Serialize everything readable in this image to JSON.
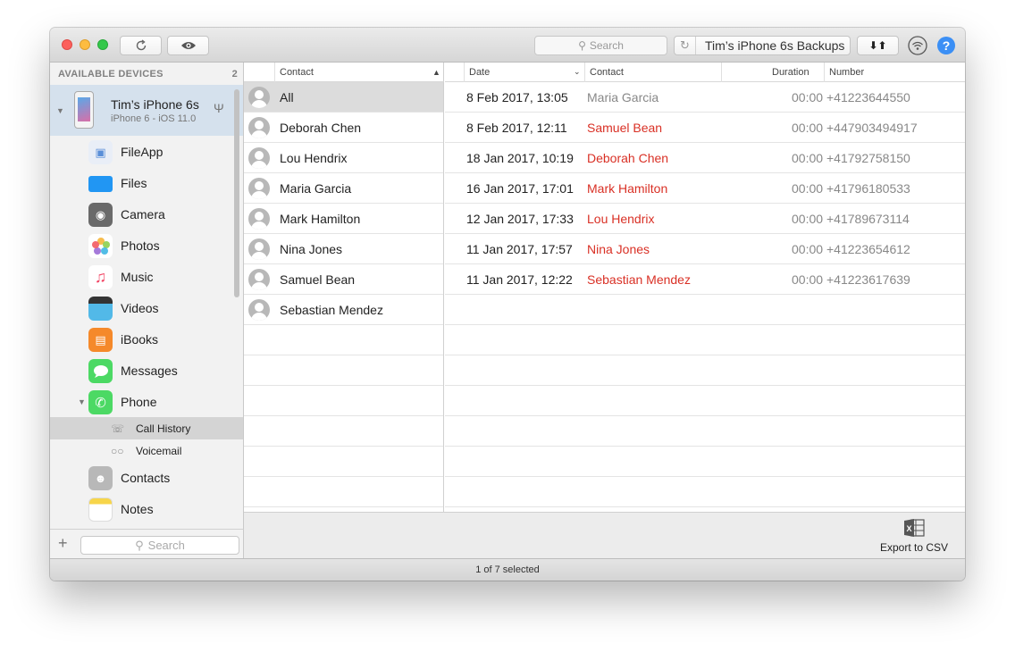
{
  "toolbar": {
    "search_placeholder": "Search",
    "backup_label": "Tim’s iPhone 6s Backups",
    "help_label": "?"
  },
  "sidebar": {
    "section_title": "AVAILABLE DEVICES",
    "device_count": "2",
    "device": {
      "name": "Tim’s iPhone 6s",
      "subtitle": "iPhone 6 - iOS 11.0"
    },
    "apps": [
      {
        "label": "FileApp",
        "icon": "fileapp-icon",
        "color": "#5a8fd8"
      },
      {
        "label": "Files",
        "icon": "files-icon",
        "color": "#2196f3"
      },
      {
        "label": "Camera",
        "icon": "camera-icon",
        "color": "#555555"
      },
      {
        "label": "Photos",
        "icon": "photos-icon",
        "color": "#f0a030"
      },
      {
        "label": "Music",
        "icon": "music-icon",
        "color": "#f24766"
      },
      {
        "label": "Videos",
        "icon": "videos-icon",
        "color": "#3aa7e0"
      },
      {
        "label": "iBooks",
        "icon": "ibooks-icon",
        "color": "#f5892a"
      },
      {
        "label": "Messages",
        "icon": "messages-icon",
        "color": "#4cd964"
      },
      {
        "label": "Phone",
        "icon": "phone-icon",
        "color": "#4cd964"
      }
    ],
    "phone_sub": [
      {
        "label": "Call History",
        "icon": "handset-icon"
      },
      {
        "label": "Voicemail",
        "icon": "voicemail-icon"
      }
    ],
    "more_apps": [
      {
        "label": "Contacts",
        "icon": "contacts-icon",
        "color": "#a8a8a8"
      },
      {
        "label": "Notes",
        "icon": "notes-icon",
        "color": "#f7d54a"
      }
    ],
    "search_placeholder": "Search"
  },
  "contacts": {
    "header": "Contact",
    "items": [
      "All",
      "Deborah Chen",
      "Lou Hendrix",
      "Maria Garcia",
      "Mark Hamilton",
      "Nina Jones",
      "Samuel Bean",
      "Sebastian Mendez"
    ]
  },
  "calls": {
    "headers": {
      "date": "Date",
      "contact": "Contact",
      "duration": "Duration",
      "number": "Number"
    },
    "rows": [
      {
        "date": "8 Feb 2017, 13:05",
        "contact": "Maria Garcia",
        "duration": "00:00",
        "number": "+41223644550",
        "missed": false
      },
      {
        "date": "8 Feb 2017, 12:11",
        "contact": "Samuel Bean",
        "duration": "00:00",
        "number": "+447903494917",
        "missed": true
      },
      {
        "date": "18 Jan 2017, 10:19",
        "contact": "Deborah Chen",
        "duration": "00:00",
        "number": "+41792758150",
        "missed": true
      },
      {
        "date": "16 Jan 2017, 17:01",
        "contact": "Mark Hamilton",
        "duration": "00:00",
        "number": "+41796180533",
        "missed": true
      },
      {
        "date": "12 Jan 2017, 17:33",
        "contact": "Lou Hendrix",
        "duration": "00:00",
        "number": "+41789673114",
        "missed": true
      },
      {
        "date": "11 Jan 2017, 17:57",
        "contact": "Nina Jones",
        "duration": "00:00",
        "number": "+41223654612",
        "missed": true
      },
      {
        "date": "11 Jan 2017, 12:22",
        "contact": "Sebastian Mendez",
        "duration": "00:00",
        "number": "+41223617639",
        "missed": true
      }
    ],
    "colors": {
      "missed": "#d93025",
      "normal": "#888888"
    }
  },
  "actions": {
    "export_label": "Export to CSV"
  },
  "status": {
    "text": "1 of 7 selected"
  }
}
